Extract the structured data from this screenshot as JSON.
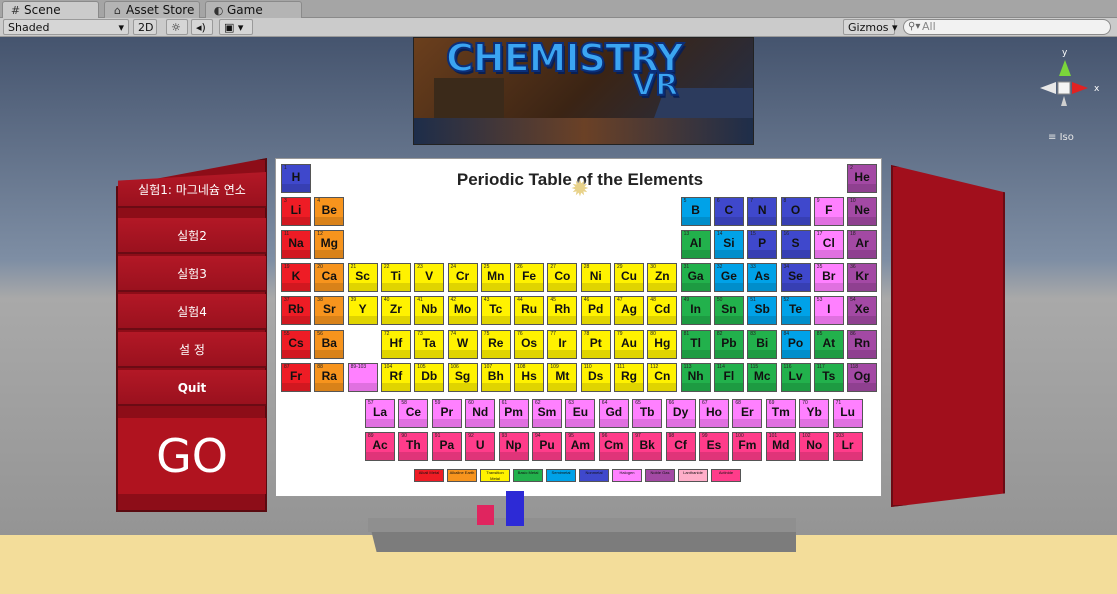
{
  "tabs": [
    {
      "icon": "#",
      "label": "Scene",
      "active": true
    },
    {
      "icon": "⌂",
      "label": "Asset Store"
    },
    {
      "icon": "◐",
      "label": "Game"
    }
  ],
  "toolbar": {
    "shading_mode": "Shaded",
    "mode_2d": "2D",
    "gizmos_label": "Gizmos",
    "search_placeholder": "All"
  },
  "gizmo": {
    "y_label": "y",
    "x_label": "x",
    "projection": "Iso"
  },
  "banner": {
    "logo_main": "CHEMISTRY",
    "logo_sub": "VR"
  },
  "menu": {
    "items": [
      "실험1:  마그네슘 연소",
      "실험2",
      "실험3",
      "실험4",
      "설 정",
      "Quit"
    ],
    "go_label": "GO"
  },
  "periodic_table": {
    "title": "Periodic Table of the Elements",
    "elements": [
      {
        "n": "1",
        "s": "H",
        "g": 1,
        "p": 1
      },
      {
        "n": "2",
        "s": "He",
        "g": 18,
        "p": 1
      },
      {
        "n": "3",
        "s": "Li",
        "g": 1,
        "p": 2
      },
      {
        "n": "4",
        "s": "Be",
        "g": 2,
        "p": 2
      },
      {
        "n": "5",
        "s": "B",
        "g": 13,
        "p": 2
      },
      {
        "n": "6",
        "s": "C",
        "g": 14,
        "p": 2
      },
      {
        "n": "7",
        "s": "N",
        "g": 15,
        "p": 2
      },
      {
        "n": "8",
        "s": "O",
        "g": 16,
        "p": 2
      },
      {
        "n": "9",
        "s": "F",
        "g": 17,
        "p": 2
      },
      {
        "n": "10",
        "s": "Ne",
        "g": 18,
        "p": 2
      },
      {
        "n": "11",
        "s": "Na",
        "g": 1,
        "p": 3
      },
      {
        "n": "12",
        "s": "Mg",
        "g": 2,
        "p": 3
      },
      {
        "n": "13",
        "s": "Al",
        "g": 13,
        "p": 3
      },
      {
        "n": "14",
        "s": "Si",
        "g": 14,
        "p": 3
      },
      {
        "n": "15",
        "s": "P",
        "g": 15,
        "p": 3
      },
      {
        "n": "16",
        "s": "S",
        "g": 16,
        "p": 3
      },
      {
        "n": "17",
        "s": "Cl",
        "g": 17,
        "p": 3
      },
      {
        "n": "18",
        "s": "Ar",
        "g": 18,
        "p": 3
      },
      {
        "n": "19",
        "s": "K",
        "g": 1,
        "p": 4
      },
      {
        "n": "20",
        "s": "Ca",
        "g": 2,
        "p": 4
      },
      {
        "n": "21",
        "s": "Sc",
        "g": 3,
        "p": 4
      },
      {
        "n": "22",
        "s": "Ti",
        "g": 4,
        "p": 4
      },
      {
        "n": "23",
        "s": "V",
        "g": 5,
        "p": 4
      },
      {
        "n": "24",
        "s": "Cr",
        "g": 6,
        "p": 4
      },
      {
        "n": "25",
        "s": "Mn",
        "g": 7,
        "p": 4
      },
      {
        "n": "26",
        "s": "Fe",
        "g": 8,
        "p": 4
      },
      {
        "n": "27",
        "s": "Co",
        "g": 9,
        "p": 4
      },
      {
        "n": "28",
        "s": "Ni",
        "g": 10,
        "p": 4
      },
      {
        "n": "29",
        "s": "Cu",
        "g": 11,
        "p": 4
      },
      {
        "n": "30",
        "s": "Zn",
        "g": 12,
        "p": 4
      },
      {
        "n": "31",
        "s": "Ga",
        "g": 13,
        "p": 4
      },
      {
        "n": "32",
        "s": "Ge",
        "g": 14,
        "p": 4
      },
      {
        "n": "33",
        "s": "As",
        "g": 15,
        "p": 4
      },
      {
        "n": "34",
        "s": "Se",
        "g": 16,
        "p": 4
      },
      {
        "n": "35",
        "s": "Br",
        "g": 17,
        "p": 4
      },
      {
        "n": "36",
        "s": "Kr",
        "g": 18,
        "p": 4
      },
      {
        "n": "37",
        "s": "Rb",
        "g": 1,
        "p": 5
      },
      {
        "n": "38",
        "s": "Sr",
        "g": 2,
        "p": 5
      },
      {
        "n": "39",
        "s": "Y",
        "g": 3,
        "p": 5
      },
      {
        "n": "40",
        "s": "Zr",
        "g": 4,
        "p": 5
      },
      {
        "n": "41",
        "s": "Nb",
        "g": 5,
        "p": 5
      },
      {
        "n": "42",
        "s": "Mo",
        "g": 6,
        "p": 5
      },
      {
        "n": "43",
        "s": "Tc",
        "g": 7,
        "p": 5
      },
      {
        "n": "44",
        "s": "Ru",
        "g": 8,
        "p": 5
      },
      {
        "n": "45",
        "s": "Rh",
        "g": 9,
        "p": 5
      },
      {
        "n": "46",
        "s": "Pd",
        "g": 10,
        "p": 5
      },
      {
        "n": "47",
        "s": "Ag",
        "g": 11,
        "p": 5
      },
      {
        "n": "48",
        "s": "Cd",
        "g": 12,
        "p": 5
      },
      {
        "n": "49",
        "s": "In",
        "g": 13,
        "p": 5
      },
      {
        "n": "50",
        "s": "Sn",
        "g": 14,
        "p": 5
      },
      {
        "n": "51",
        "s": "Sb",
        "g": 15,
        "p": 5
      },
      {
        "n": "52",
        "s": "Te",
        "g": 16,
        "p": 5
      },
      {
        "n": "53",
        "s": "I",
        "g": 17,
        "p": 5
      },
      {
        "n": "54",
        "s": "Xe",
        "g": 18,
        "p": 5
      },
      {
        "n": "55",
        "s": "Cs",
        "g": 1,
        "p": 6
      },
      {
        "n": "56",
        "s": "Ba",
        "g": 2,
        "p": 6
      },
      {
        "n": "72",
        "s": "Hf",
        "g": 4,
        "p": 6
      },
      {
        "n": "73",
        "s": "Ta",
        "g": 5,
        "p": 6
      },
      {
        "n": "74",
        "s": "W",
        "g": 6,
        "p": 6
      },
      {
        "n": "75",
        "s": "Re",
        "g": 7,
        "p": 6
      },
      {
        "n": "76",
        "s": "Os",
        "g": 8,
        "p": 6
      },
      {
        "n": "77",
        "s": "Ir",
        "g": 9,
        "p": 6
      },
      {
        "n": "78",
        "s": "Pt",
        "g": 10,
        "p": 6
      },
      {
        "n": "79",
        "s": "Au",
        "g": 11,
        "p": 6
      },
      {
        "n": "80",
        "s": "Hg",
        "g": 12,
        "p": 6
      },
      {
        "n": "81",
        "s": "Tl",
        "g": 13,
        "p": 6
      },
      {
        "n": "82",
        "s": "Pb",
        "g": 14,
        "p": 6
      },
      {
        "n": "83",
        "s": "Bi",
        "g": 15,
        "p": 6
      },
      {
        "n": "84",
        "s": "Po",
        "g": 16,
        "p": 6
      },
      {
        "n": "85",
        "s": "At",
        "g": 17,
        "p": 6
      },
      {
        "n": "86",
        "s": "Rn",
        "g": 18,
        "p": 6
      },
      {
        "n": "87",
        "s": "Fr",
        "g": 1,
        "p": 7
      },
      {
        "n": "88",
        "s": "Ra",
        "g": 2,
        "p": 7
      },
      {
        "n": "89-103",
        "s": "",
        "g": 3,
        "p": 7
      },
      {
        "n": "104",
        "s": "Rf",
        "g": 4,
        "p": 7
      },
      {
        "n": "105",
        "s": "Db",
        "g": 5,
        "p": 7
      },
      {
        "n": "106",
        "s": "Sg",
        "g": 6,
        "p": 7
      },
      {
        "n": "107",
        "s": "Bh",
        "g": 7,
        "p": 7
      },
      {
        "n": "108",
        "s": "Hs",
        "g": 8,
        "p": 7
      },
      {
        "n": "109",
        "s": "Mt",
        "g": 9,
        "p": 7
      },
      {
        "n": "110",
        "s": "Ds",
        "g": 10,
        "p": 7
      },
      {
        "n": "111",
        "s": "Rg",
        "g": 11,
        "p": 7
      },
      {
        "n": "112",
        "s": "Cn",
        "g": 12,
        "p": 7
      },
      {
        "n": "113",
        "s": "Nh",
        "g": 13,
        "p": 7
      },
      {
        "n": "114",
        "s": "Fl",
        "g": 14,
        "p": 7
      },
      {
        "n": "115",
        "s": "Mc",
        "g": 15,
        "p": 7
      },
      {
        "n": "116",
        "s": "Lv",
        "g": 16,
        "p": 7
      },
      {
        "n": "117",
        "s": "Ts",
        "g": 17,
        "p": 7
      },
      {
        "n": "118",
        "s": "Og",
        "g": 18,
        "p": 7
      }
    ],
    "lanthanides": [
      "La",
      "Ce",
      "Pr",
      "Nd",
      "Pm",
      "Sm",
      "Eu",
      "Gd",
      "Tb",
      "Dy",
      "Ho",
      "Er",
      "Tm",
      "Yb",
      "Lu"
    ],
    "actinides": [
      "Ac",
      "Th",
      "Pa",
      "U",
      "Np",
      "Pu",
      "Am",
      "Cm",
      "Bk",
      "Cf",
      "Es",
      "Fm",
      "Md",
      "No",
      "Lr"
    ],
    "legend": [
      "Alkali Metal",
      "Alkaline Earth",
      "Transition Metal",
      "Basic Metal",
      "Semimetal",
      "Nonmetal",
      "Halogen",
      "Noble Gas",
      "Lanthanide",
      "Actinide"
    ]
  },
  "colors": {
    "alkali": "#ee1c25",
    "alkaline": "#f7941d",
    "transition": "#fff200",
    "basic": "#22b14c",
    "semimetal": "#00a2e8",
    "nonmetal": "#3f48cc",
    "halogen": "#ff80ff",
    "noble": "#a349a4",
    "lanthanide": "#ffaec9",
    "actinide": "#ff3c8a",
    "menu_red": "#b31826",
    "floor": "#f3dd9a"
  }
}
